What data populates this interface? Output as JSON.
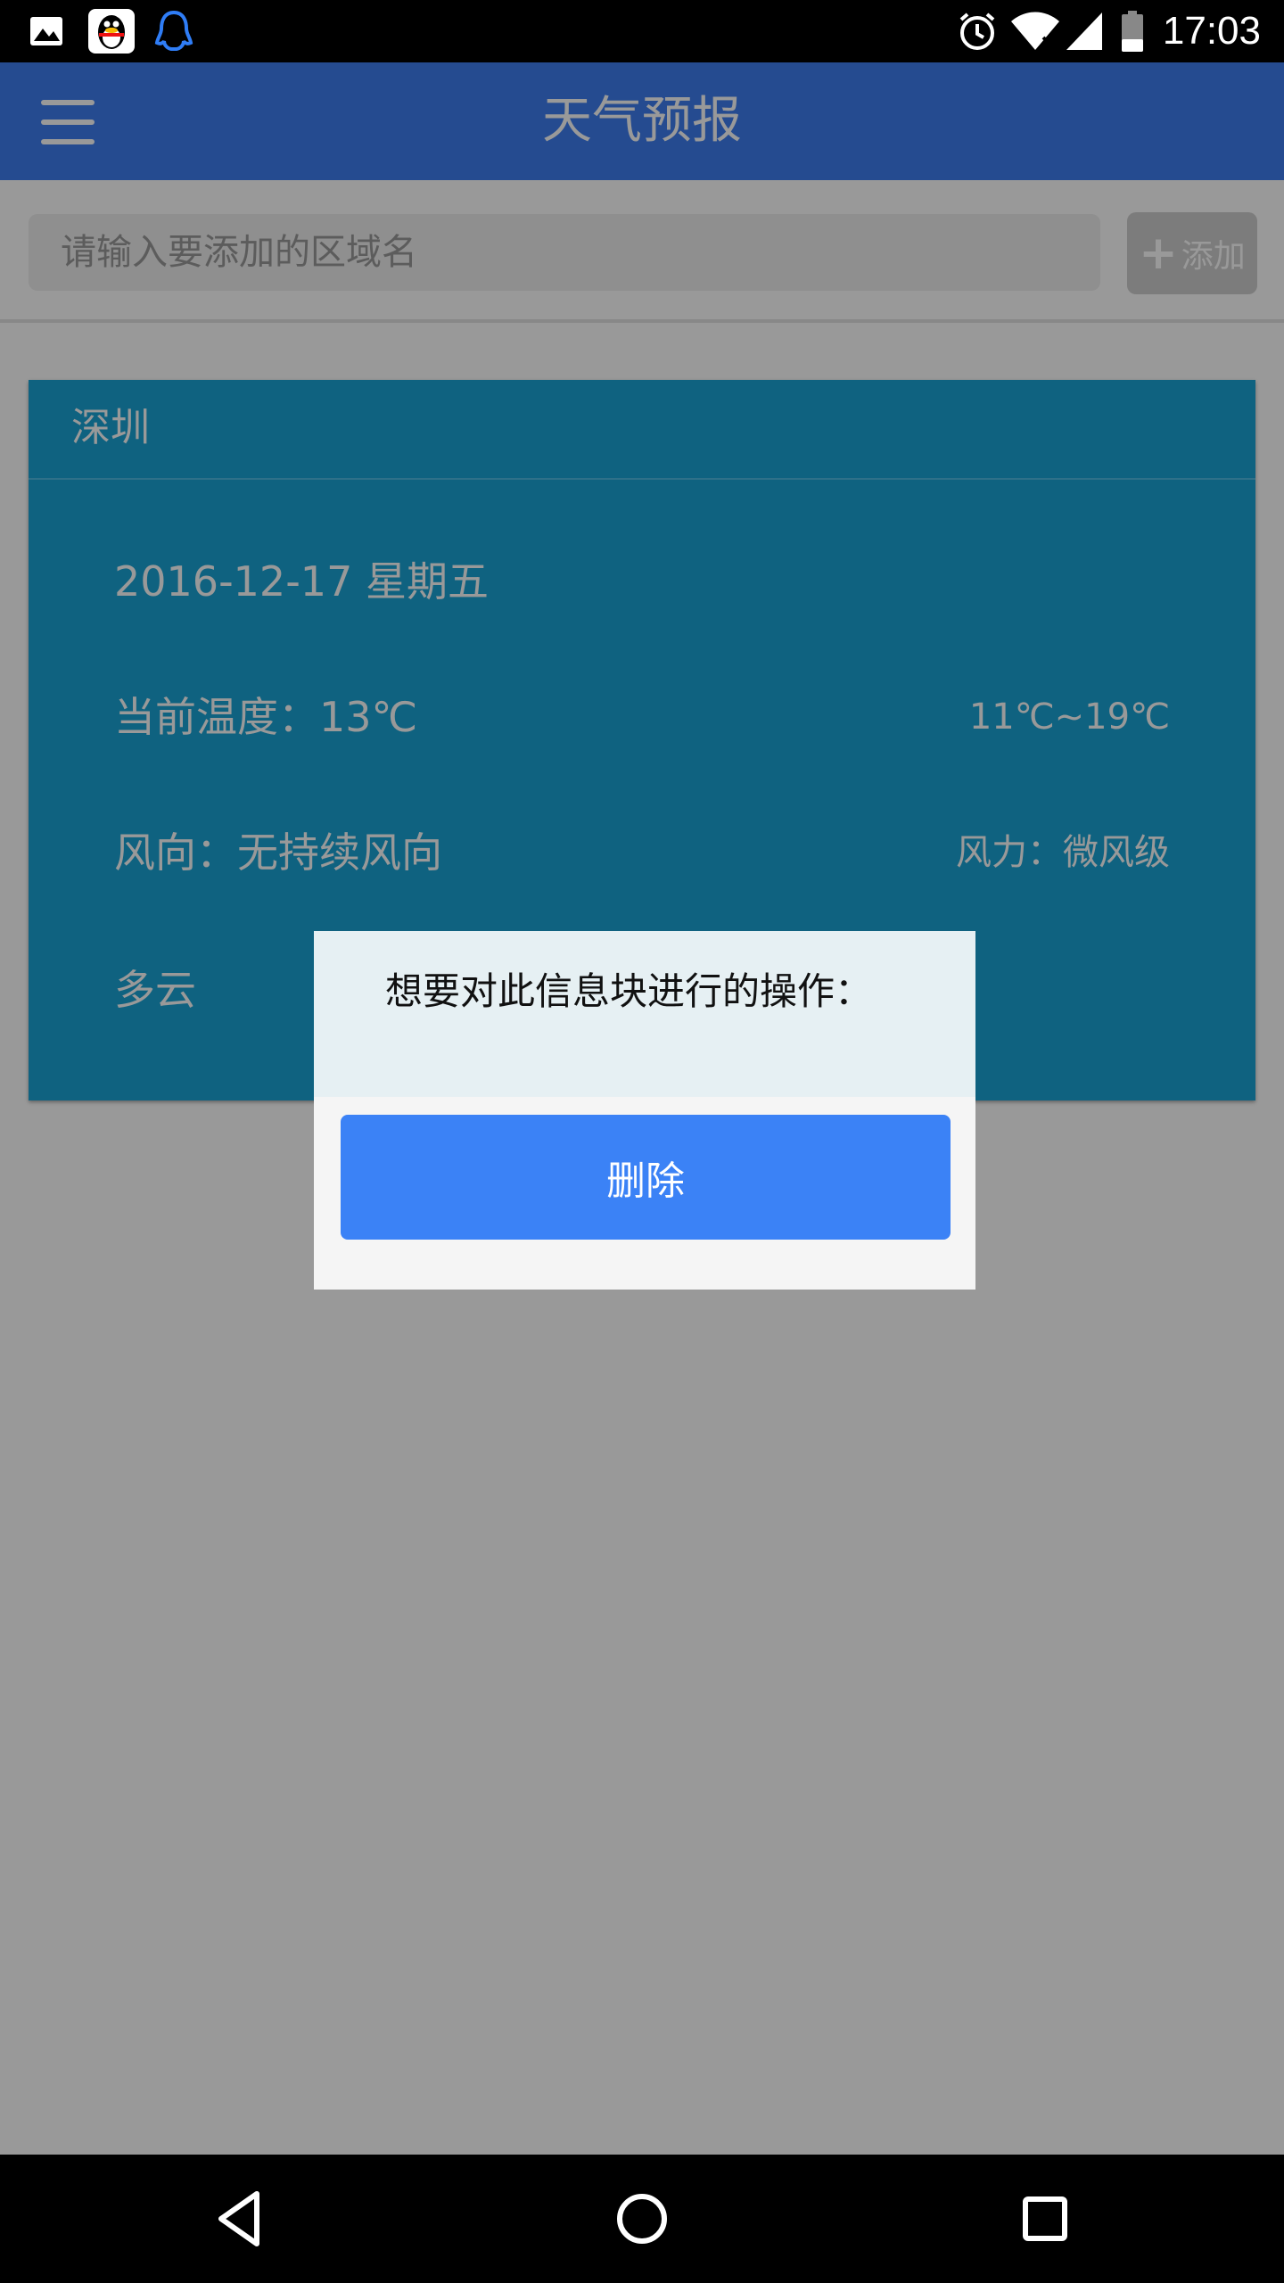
{
  "status_bar": {
    "time": "17:03",
    "left_icons": [
      "image-icon",
      "qq-icon",
      "qq-outline-icon"
    ],
    "right_icons": [
      "alarm-icon",
      "wifi-icon",
      "signal-icon",
      "battery-icon"
    ]
  },
  "app_bar": {
    "title": "天气预报",
    "menu_icon": "hamburger-menu-icon",
    "color": "#3f7ef0"
  },
  "search": {
    "placeholder": "请输入要添加的区域名",
    "value": "",
    "add_label": "添加",
    "add_icon": "plus-icon"
  },
  "weather_card": {
    "city": "深圳",
    "date": "2016-12-17 星期五",
    "current_temp": "当前温度：13℃",
    "temp_range": "11℃~19℃",
    "wind_direction": "风向：无持续风向",
    "wind_power": "风力：微风级",
    "condition": "多云",
    "color": "#1aa4d6"
  },
  "dialog": {
    "message": "想要对此信息块进行的操作：",
    "delete_label": "删除",
    "button_color": "#3b82f6"
  },
  "nav_bar": {
    "icons": [
      "back-icon",
      "home-icon",
      "recents-icon"
    ]
  }
}
